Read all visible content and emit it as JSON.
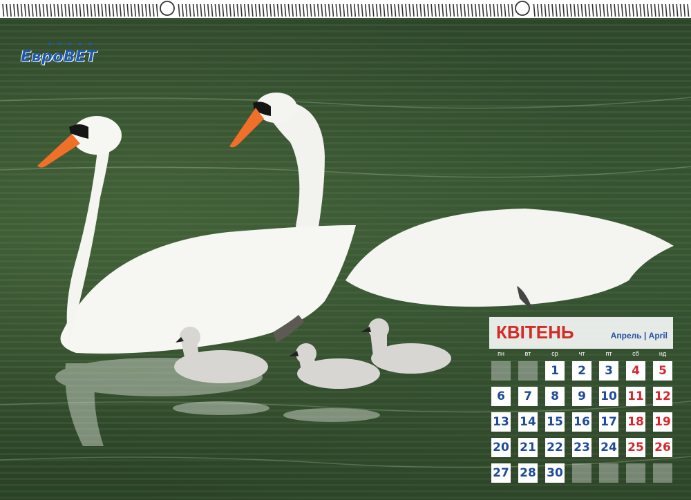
{
  "logo": {
    "text": "ЕвроВЕТ",
    "stars": "★ ★ ★ ★ ★"
  },
  "calendar": {
    "month": "КВІТЕНЬ",
    "subtitle": "Апрель | April",
    "weekdays": [
      "пн",
      "вт",
      "ср",
      "чт",
      "пт",
      "сб",
      "нд"
    ],
    "weeks": [
      [
        "",
        "",
        "1",
        "2",
        "3",
        "4",
        "5"
      ],
      [
        "6",
        "7",
        "8",
        "9",
        "10",
        "11",
        "12"
      ],
      [
        "13",
        "14",
        "15",
        "16",
        "17",
        "18",
        "19"
      ],
      [
        "20",
        "21",
        "22",
        "23",
        "24",
        "25",
        "26"
      ],
      [
        "27",
        "28",
        "30",
        "",
        "",
        "",
        ""
      ]
    ],
    "weekday_color": "#1e4a9a",
    "weekend_color": "#d6262b"
  },
  "colors": {
    "water": "#3a5a34",
    "brand": "#1e5aa8",
    "accent": "#d42a26"
  }
}
